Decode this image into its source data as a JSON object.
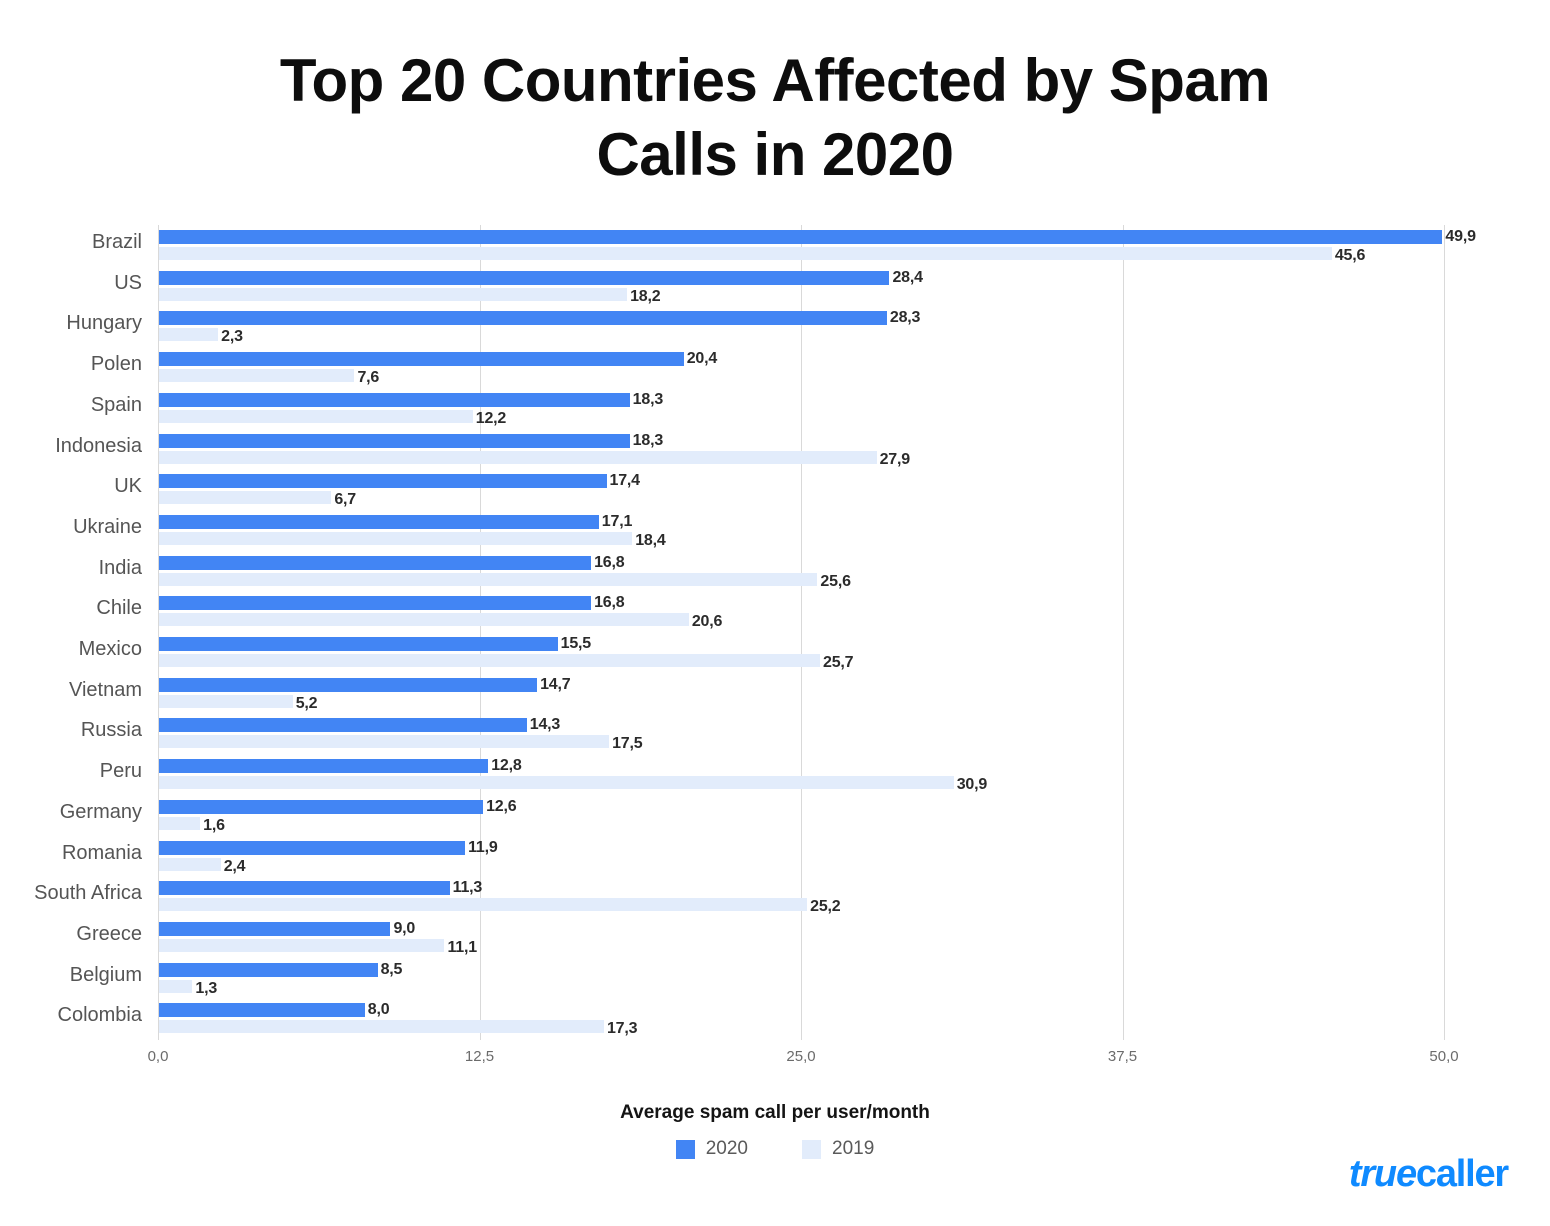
{
  "title": "Top 20 Countries Affected by Spam\nCalls in 2020",
  "axis_caption": "Average spam call per user/month",
  "legend": [
    {
      "label": "2020",
      "color": "#4285f4",
      "swatch_name": "legend-swatch-2020"
    },
    {
      "label": "2019",
      "color": "#e2ecfb",
      "swatch_name": "legend-swatch-2019"
    }
  ],
  "brand": {
    "part1": "true",
    "part2": "caller",
    "color": "#0f8aff"
  },
  "chart_data": {
    "type": "bar",
    "orientation": "horizontal",
    "title": "Top 20 Countries Affected by Spam Calls in 2020",
    "xlabel": "Average spam call per user/month",
    "ylabel": "",
    "xlim": [
      0.0,
      50.0
    ],
    "xticks": [
      0.0,
      12.5,
      25.0,
      37.5,
      50.0
    ],
    "xtick_labels": [
      "0,0",
      "12,5",
      "25,0",
      "37,5",
      "50,0"
    ],
    "grid": "vertical",
    "legend_position": "bottom-center",
    "decimal_separator": ",",
    "categories": [
      "Brazil",
      "US",
      "Hungary",
      "Polen",
      "Spain",
      "Indonesia",
      "UK",
      "Ukraine",
      "India",
      "Chile",
      "Mexico",
      "Vietnam",
      "Russia",
      "Peru",
      "Germany",
      "Romania",
      "South Africa",
      "Greece",
      "Belgium",
      "Colombia"
    ],
    "series": [
      {
        "name": "2020",
        "color": "#4285f4",
        "values": [
          49.9,
          28.4,
          28.3,
          20.4,
          18.3,
          18.3,
          17.4,
          17.1,
          16.8,
          16.8,
          15.5,
          14.7,
          14.3,
          12.8,
          12.6,
          11.9,
          11.3,
          9.0,
          8.5,
          8.0
        ],
        "labels": [
          "49,9",
          "28,4",
          "28,3",
          "20,4",
          "18,3",
          "18,3",
          "17,4",
          "17,1",
          "16,8",
          "16,8",
          "15,5",
          "14,7",
          "14,3",
          "12,8",
          "12,6",
          "11,9",
          "11,3",
          "9,0",
          "8,5",
          "8,0"
        ]
      },
      {
        "name": "2019",
        "color": "#e2ecfb",
        "values": [
          45.6,
          18.2,
          2.3,
          7.6,
          12.2,
          27.9,
          6.7,
          18.4,
          25.6,
          20.6,
          25.7,
          5.2,
          17.5,
          30.9,
          1.6,
          2.4,
          25.2,
          11.1,
          1.3,
          17.3
        ],
        "labels": [
          "45,6",
          "18,2",
          "2,3",
          "7,6",
          "12,2",
          "27,9",
          "6,7",
          "18,4",
          "25,6",
          "20,6",
          "25,7",
          "5,2",
          "17,5",
          "30,9",
          "1,6",
          "2,4",
          "25,2",
          "11,1",
          "1,3",
          "17,3"
        ]
      }
    ]
  }
}
